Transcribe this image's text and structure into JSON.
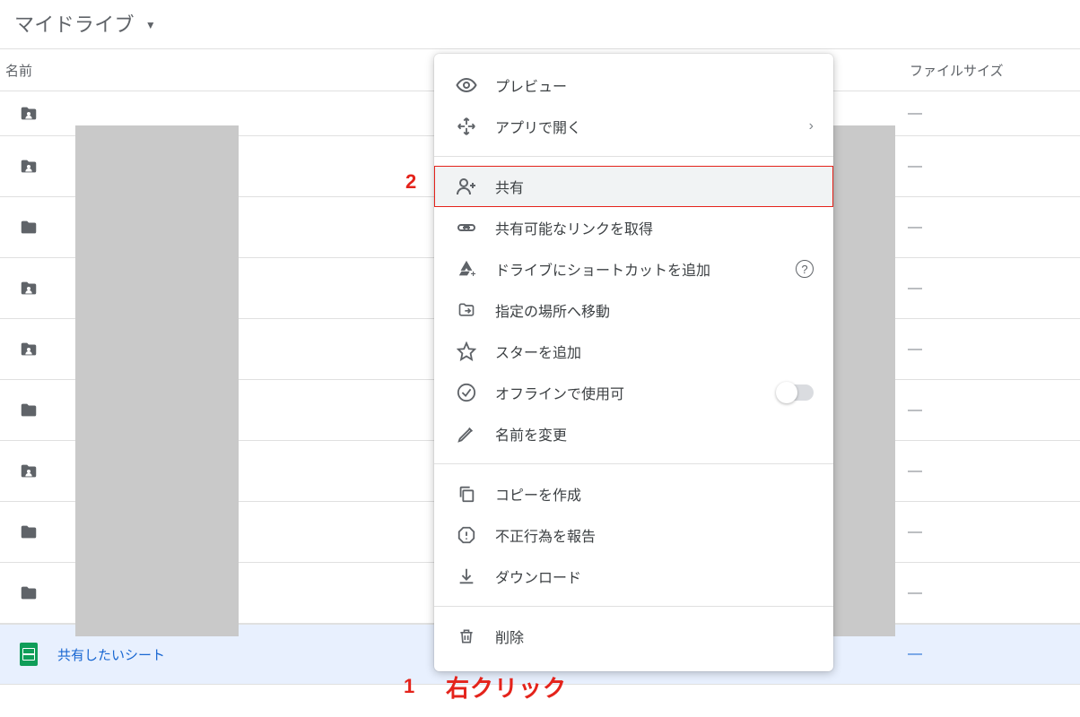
{
  "header": {
    "title": "マイドライブ"
  },
  "columns": {
    "name": "名前",
    "size": "ファイルサイズ"
  },
  "rows": [
    {
      "type": "person-folder",
      "name": "",
      "size": "—",
      "short": true
    },
    {
      "type": "person-folder",
      "name": "",
      "size": "—"
    },
    {
      "type": "folder",
      "name": "",
      "size": "—"
    },
    {
      "type": "person-folder",
      "name": "",
      "size": "—"
    },
    {
      "type": "person-folder",
      "name": "",
      "size": "—"
    },
    {
      "type": "folder",
      "name": "",
      "size": "—"
    },
    {
      "type": "person-folder",
      "name": "",
      "size": "—"
    },
    {
      "type": "folder",
      "name": "",
      "size": "—"
    },
    {
      "type": "folder",
      "name": "",
      "size": "—"
    }
  ],
  "selected_row": {
    "name": "共有したいシート",
    "size": "—"
  },
  "menu": {
    "preview": "プレビュー",
    "open_with": "アプリで開く",
    "share": "共有",
    "get_link": "共有可能なリンクを取得",
    "add_shortcut": "ドライブにショートカットを追加",
    "move": "指定の場所へ移動",
    "star": "スターを追加",
    "offline": "オフラインで使用可",
    "rename": "名前を変更",
    "copy": "コピーを作成",
    "report": "不正行為を報告",
    "download": "ダウンロード",
    "delete": "削除"
  },
  "annotations": {
    "step1_num": "1",
    "step1_text": "右クリック",
    "step2_num": "2"
  }
}
